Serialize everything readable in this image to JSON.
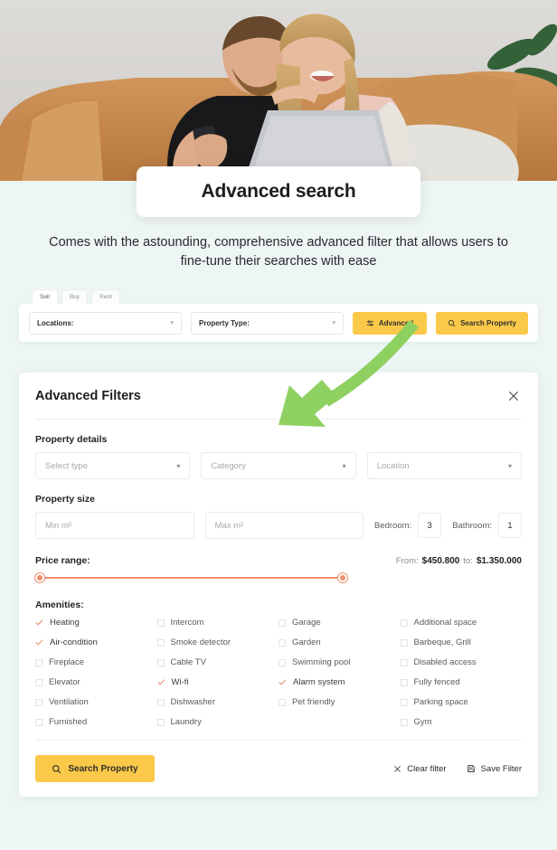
{
  "hero": {
    "alt": "couple on orange leather sofa looking at laptop"
  },
  "header": {
    "title": "Advanced search",
    "subtitle": "Comes with the astounding, comprehensive advanced filter that allows users to fine-tune their searches with ease"
  },
  "searchbar": {
    "tabs": [
      {
        "label": "Sell",
        "active": true
      },
      {
        "label": "Buy",
        "active": false
      },
      {
        "label": "Rent",
        "active": false
      }
    ],
    "location_label": "Locations:",
    "property_type_label": "Property Type:",
    "advanced_button": "Advanced",
    "search_button": "Search Property"
  },
  "filters": {
    "title": "Advanced Filters",
    "property_details": {
      "label": "Property details",
      "type_placeholder": "Select type",
      "category_placeholder": "Category",
      "location_placeholder": "Location"
    },
    "property_size": {
      "label": "Property size",
      "min_placeholder": "Min m²",
      "max_placeholder": "Max m²",
      "bedroom_label": "Bedroom:",
      "bedroom_value": "3",
      "bathroom_label": "Bathroom:",
      "bathroom_value": "1"
    },
    "price_range": {
      "label": "Price range:",
      "from_label": "From:",
      "from_value": "$450.800",
      "to_label": "to:",
      "to_value": "$1.350.000",
      "handle_left_pct": 0,
      "handle_right_pct": 100
    },
    "amenities": {
      "label": "Amenities:",
      "columns": [
        [
          {
            "label": "Heating",
            "checked": true
          },
          {
            "label": "Air-condition",
            "checked": true
          },
          {
            "label": "Fireplace",
            "checked": false
          },
          {
            "label": "Elevator",
            "checked": false
          },
          {
            "label": "Ventilation",
            "checked": false
          },
          {
            "label": "Furnished",
            "checked": false
          }
        ],
        [
          {
            "label": "Intercom",
            "checked": false
          },
          {
            "label": "Smoke detector",
            "checked": false
          },
          {
            "label": "Cable TV",
            "checked": false
          },
          {
            "label": "Wi-fi",
            "checked": true
          },
          {
            "label": "Dishwasher",
            "checked": false
          },
          {
            "label": "Laundry",
            "checked": false
          }
        ],
        [
          {
            "label": "Garage",
            "checked": false
          },
          {
            "label": "Garden",
            "checked": false
          },
          {
            "label": "Swimming pool",
            "checked": false
          },
          {
            "label": "Alarm system",
            "checked": true
          },
          {
            "label": "Pet friendly",
            "checked": false
          }
        ],
        [
          {
            "label": "Additional space",
            "checked": false
          },
          {
            "label": "Barbeque, Grill",
            "checked": false
          },
          {
            "label": "Disabled access",
            "checked": false
          },
          {
            "label": "Fully fenced",
            "checked": false
          },
          {
            "label": "Parking space",
            "checked": false
          },
          {
            "label": "Gym",
            "checked": false
          }
        ]
      ]
    },
    "footer": {
      "search_button": "Search Property",
      "clear_button": "Clear filter",
      "save_button": "Save Filter"
    }
  },
  "annotation": {
    "type": "curved-arrow",
    "color": "#8ed161",
    "points_to": "advanced-button"
  },
  "colors": {
    "page_background": "#edf6f5",
    "accent_yellow": "#fbc949",
    "slider_coral": "#f08e6e",
    "check_coral": "#e8866a",
    "arrow_green": "#8ed161"
  }
}
